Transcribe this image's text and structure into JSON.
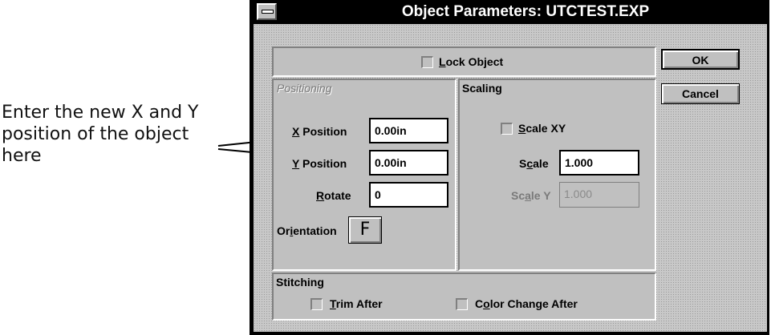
{
  "callout": {
    "text": "Enter the new X and Y position of the object here"
  },
  "dialog": {
    "title": "Object Parameters: UTCTEST.EXP",
    "lock_object": {
      "label_prefix": "",
      "label_accel": "L",
      "label_rest": "ock Object",
      "checked": false
    },
    "buttons": {
      "ok": "OK",
      "cancel": "Cancel"
    },
    "positioning": {
      "header": "Positioning",
      "x_label_accel": "X",
      "x_label_rest": " Position",
      "x_value": "0.00in",
      "y_label_accel": "Y",
      "y_label_rest": " Position",
      "y_value": "0.00in",
      "rotate_label_accel": "R",
      "rotate_label_rest": "otate",
      "rotate_value": "0",
      "orientation_label_pre": "Or",
      "orientation_label_accel": "i",
      "orientation_label_rest": "entation",
      "orientation_value": "F"
    },
    "scaling": {
      "header": "Scaling",
      "scale_xy_accel": "S",
      "scale_xy_rest": "cale XY",
      "scale_xy_checked": false,
      "scale_pre": "S",
      "scale_accel": "c",
      "scale_rest": "ale",
      "scale_value": "1.000",
      "scale_y_pre": "Sc",
      "scale_y_accel": "a",
      "scale_y_rest": "le Y",
      "scale_y_value": "1.000"
    },
    "stitching": {
      "header": "Stitching",
      "trim_accel": "T",
      "trim_rest": "rim After",
      "trim_checked": false,
      "color_pre": "C",
      "color_accel": "o",
      "color_rest": "lor Change After",
      "color_checked": false
    }
  }
}
